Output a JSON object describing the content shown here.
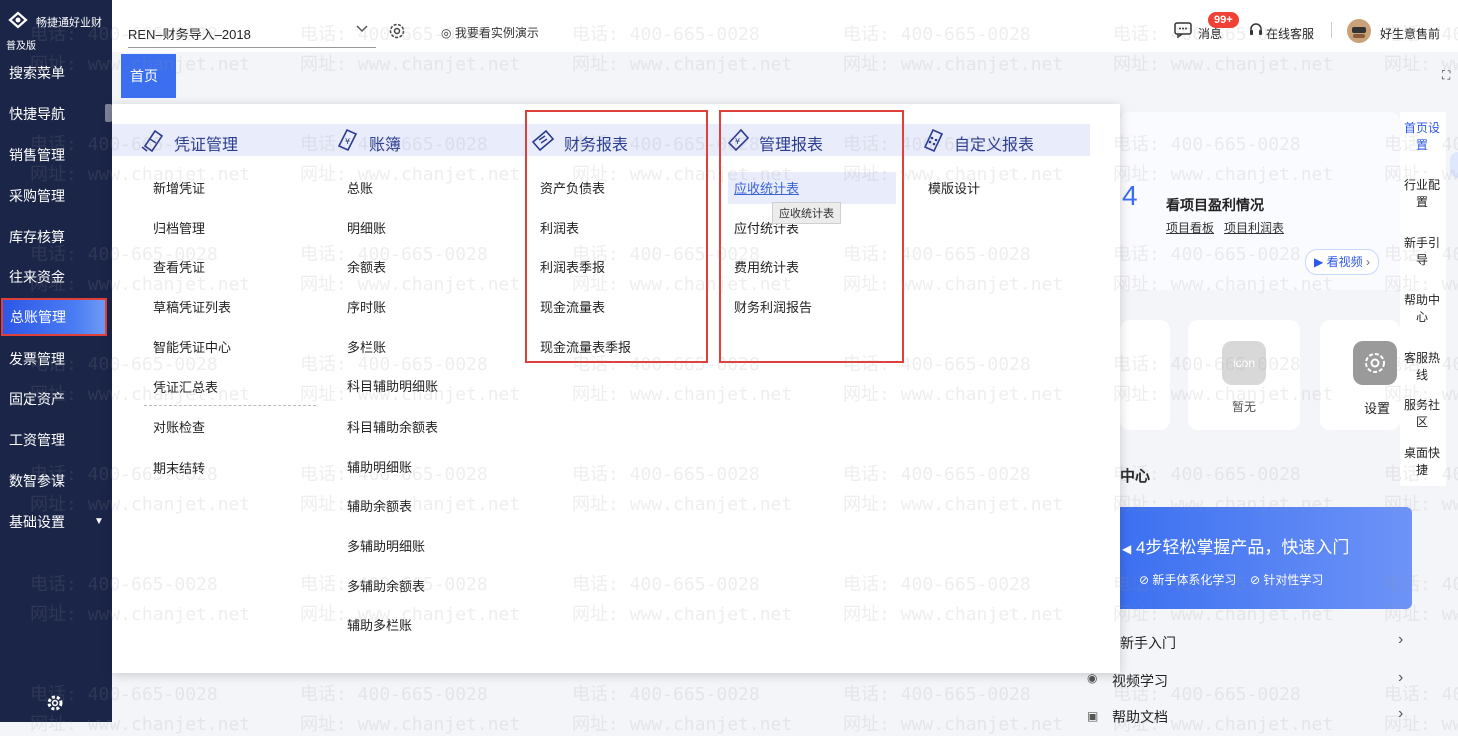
{
  "brand": {
    "name": "畅捷通好业财",
    "edition": "普及版"
  },
  "sidebar": {
    "items": [
      {
        "label": "搜索菜单"
      },
      {
        "label": "快捷导航"
      },
      {
        "label": "销售管理"
      },
      {
        "label": "采购管理"
      },
      {
        "label": "库存核算"
      },
      {
        "label": "往来资金"
      },
      {
        "label": "总账管理"
      },
      {
        "label": "发票管理"
      },
      {
        "label": "固定资产"
      },
      {
        "label": "工资管理"
      },
      {
        "label": "数智参谋"
      },
      {
        "label": "基础设置"
      }
    ],
    "active": "总账管理"
  },
  "topbar": {
    "account": "REN–财务导入–2018",
    "demo": "我要看实例演示",
    "messages": "消息",
    "message_badge": "99+",
    "customer_service": "在线客服",
    "user": "好生意售前"
  },
  "tabs": {
    "home": "首页"
  },
  "watermark": {
    "phone": "电话: 400-665-0028",
    "site": "网址: www.chanjet.net"
  },
  "menu": {
    "columns": [
      {
        "title": "凭证管理",
        "icon": "voucher-icon",
        "items": [
          "新增凭证",
          "归档管理",
          "查看凭证",
          "草稿凭证列表",
          "智能凭证中心",
          "凭证汇总表",
          "对账检查",
          "期末结转"
        ]
      },
      {
        "title": "账簿",
        "icon": "ledger-icon",
        "items": [
          "总账",
          "明细账",
          "余额表",
          "序时账",
          "多栏账",
          "科目辅助明细账",
          "科目辅助余额表",
          "辅助明细账",
          "辅助余额表",
          "多辅助明细账",
          "多辅助余额表",
          "辅助多栏账"
        ]
      },
      {
        "title": "财务报表",
        "icon": "financial-report-icon",
        "items": [
          "资产负债表",
          "利润表",
          "利润表季报",
          "现金流量表",
          "现金流量表季报"
        ]
      },
      {
        "title": "管理报表",
        "icon": "management-report-icon",
        "items": [
          "应收统计表",
          "应付统计表",
          "费用统计表",
          "财务利润报告"
        ]
      },
      {
        "title": "自定义报表",
        "icon": "custom-report-icon",
        "items": [
          "模版设计"
        ]
      }
    ],
    "tooltip": "应收统计表"
  },
  "background": {
    "project_number": "4",
    "project_title": "看项目盈利情况",
    "project_links": [
      "项目看板",
      "项目利润表"
    ],
    "watch_video": "看视频",
    "tile_none": "暂无",
    "tile_icon": "icon",
    "tile_settings": "设置",
    "center_title": "中心",
    "banner_title": "4步轻松掌握产品，快速入门",
    "banner_tags": [
      "新手体系化学习",
      "针对性学习"
    ],
    "list": [
      "新手入门",
      "视频学习",
      "帮助文档"
    ]
  },
  "right_tools": [
    {
      "label": "首页设置"
    },
    {
      "label": "行业配置"
    },
    {
      "label": "新手引导"
    },
    {
      "label": "帮助中心"
    },
    {
      "label": "客服热线"
    },
    {
      "label": "服务社区"
    },
    {
      "label": "桌面快捷"
    }
  ],
  "colors": {
    "sidebar": "#1b2548",
    "accent": "#3b6ff0",
    "highlight_box": "#e0403a",
    "badge": "#f04134"
  }
}
